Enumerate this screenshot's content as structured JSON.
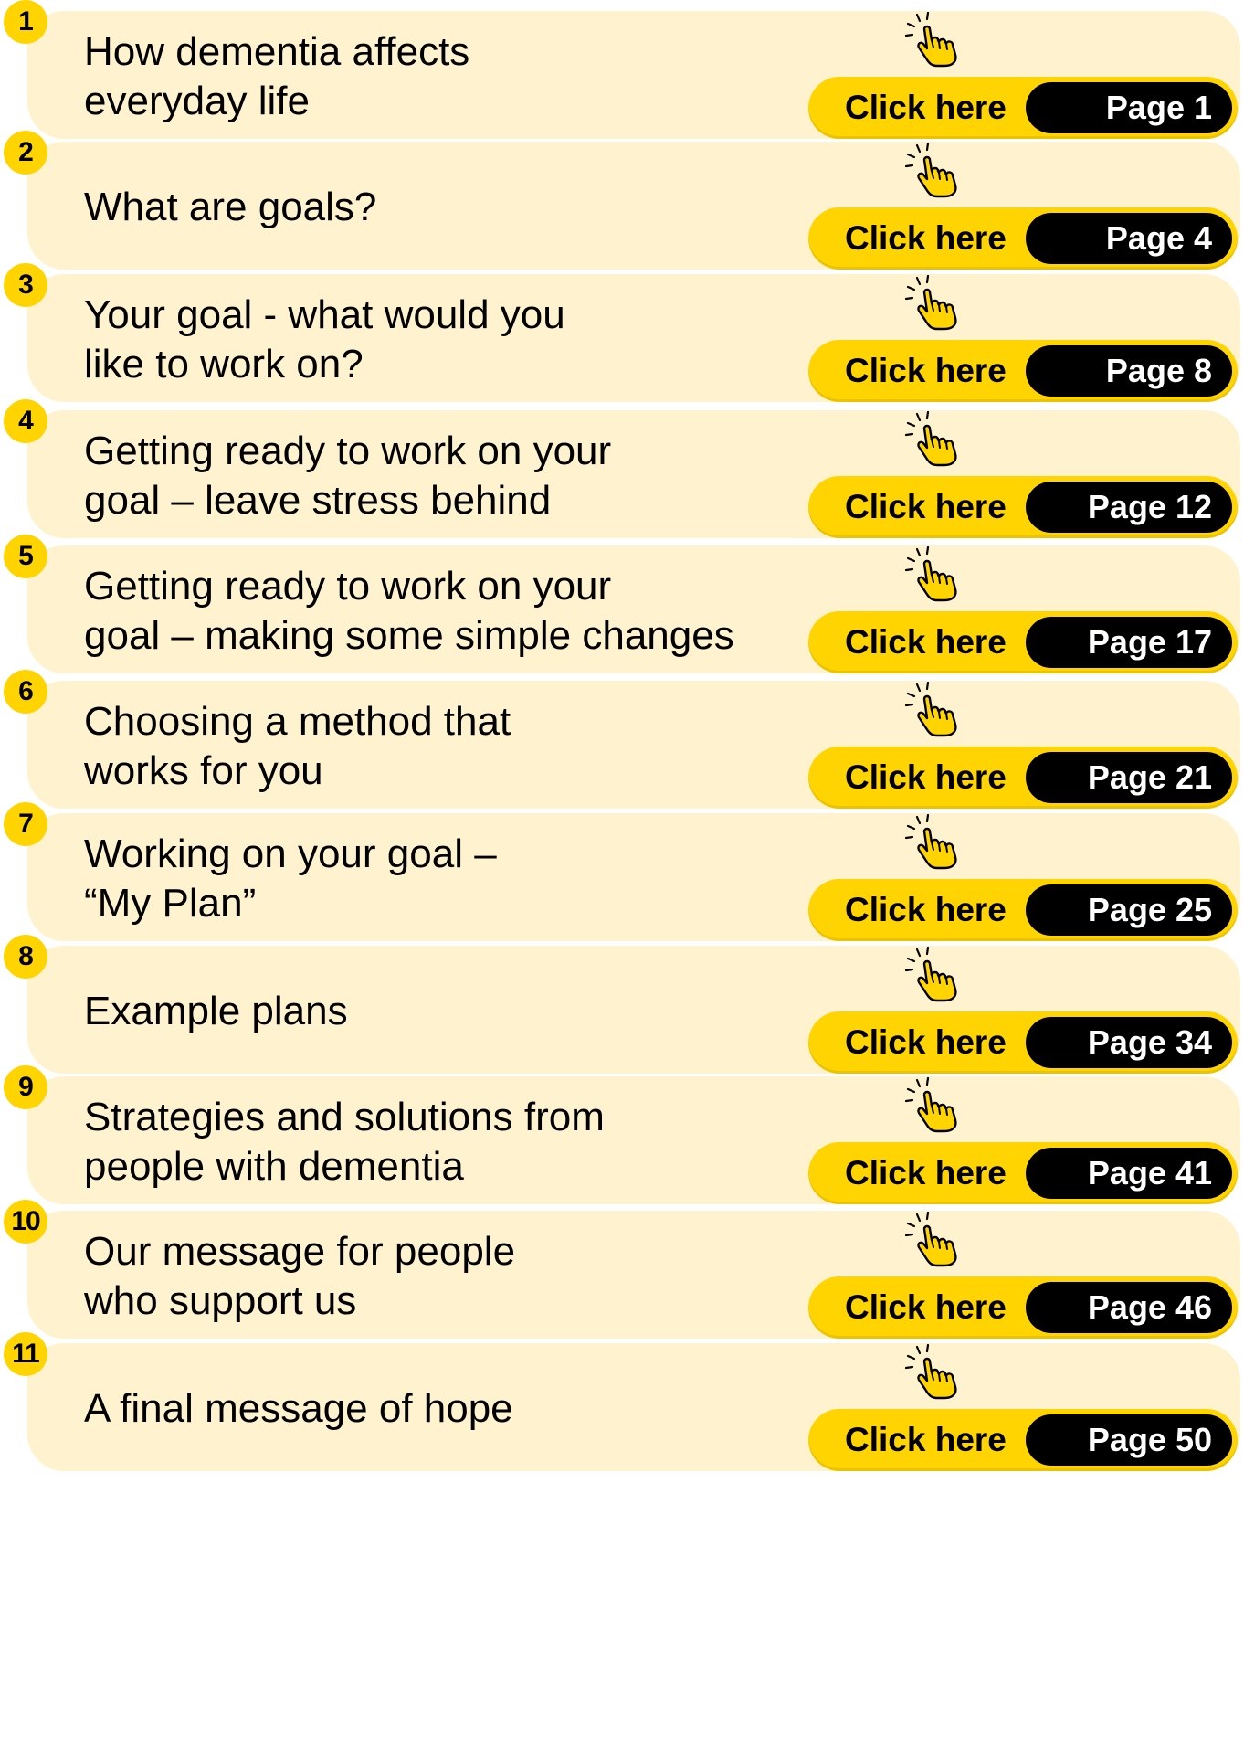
{
  "colors": {
    "accent": "#ffd400",
    "card": "#fff3cf",
    "page_pill": "#000000"
  },
  "icon": "pointing-hand-click-icon",
  "items": [
    {
      "number": "1",
      "title_lines": [
        "How dementia affects",
        "everyday life"
      ],
      "button_label": "Click here",
      "page": "Page 1"
    },
    {
      "number": "2",
      "title_lines": [
        "What are goals?"
      ],
      "button_label": "Click here",
      "page": "Page 4"
    },
    {
      "number": "3",
      "title_lines": [
        "Your goal - what would you",
        "like to work on?"
      ],
      "button_label": "Click here",
      "page": "Page 8"
    },
    {
      "number": "4",
      "title_lines": [
        "Getting ready to work on your",
        "goal – leave stress behind"
      ],
      "button_label": "Click here",
      "page": "Page 12"
    },
    {
      "number": "5",
      "title_lines": [
        "Getting ready to work on your",
        "goal – making some simple changes"
      ],
      "button_label": "Click here",
      "page": "Page 17"
    },
    {
      "number": "6",
      "title_lines": [
        "Choosing a method that",
        "works for you"
      ],
      "button_label": "Click here",
      "page": "Page 21"
    },
    {
      "number": "7",
      "title_lines": [
        "Working on your goal –",
        "“My Plan”"
      ],
      "button_label": "Click here",
      "page": "Page 25"
    },
    {
      "number": "8",
      "title_lines": [
        "Example plans"
      ],
      "button_label": "Click here",
      "page": "Page 34"
    },
    {
      "number": "9",
      "title_lines": [
        "Strategies and solutions from",
        "people with dementia"
      ],
      "button_label": "Click here",
      "page": "Page 41"
    },
    {
      "number": "10",
      "title_lines": [
        "Our message for people",
        "who support us"
      ],
      "button_label": "Click here",
      "page": "Page 46"
    },
    {
      "number": "11",
      "title_lines": [
        "A final message of hope"
      ],
      "button_label": "Click here",
      "page": "Page 50"
    }
  ]
}
